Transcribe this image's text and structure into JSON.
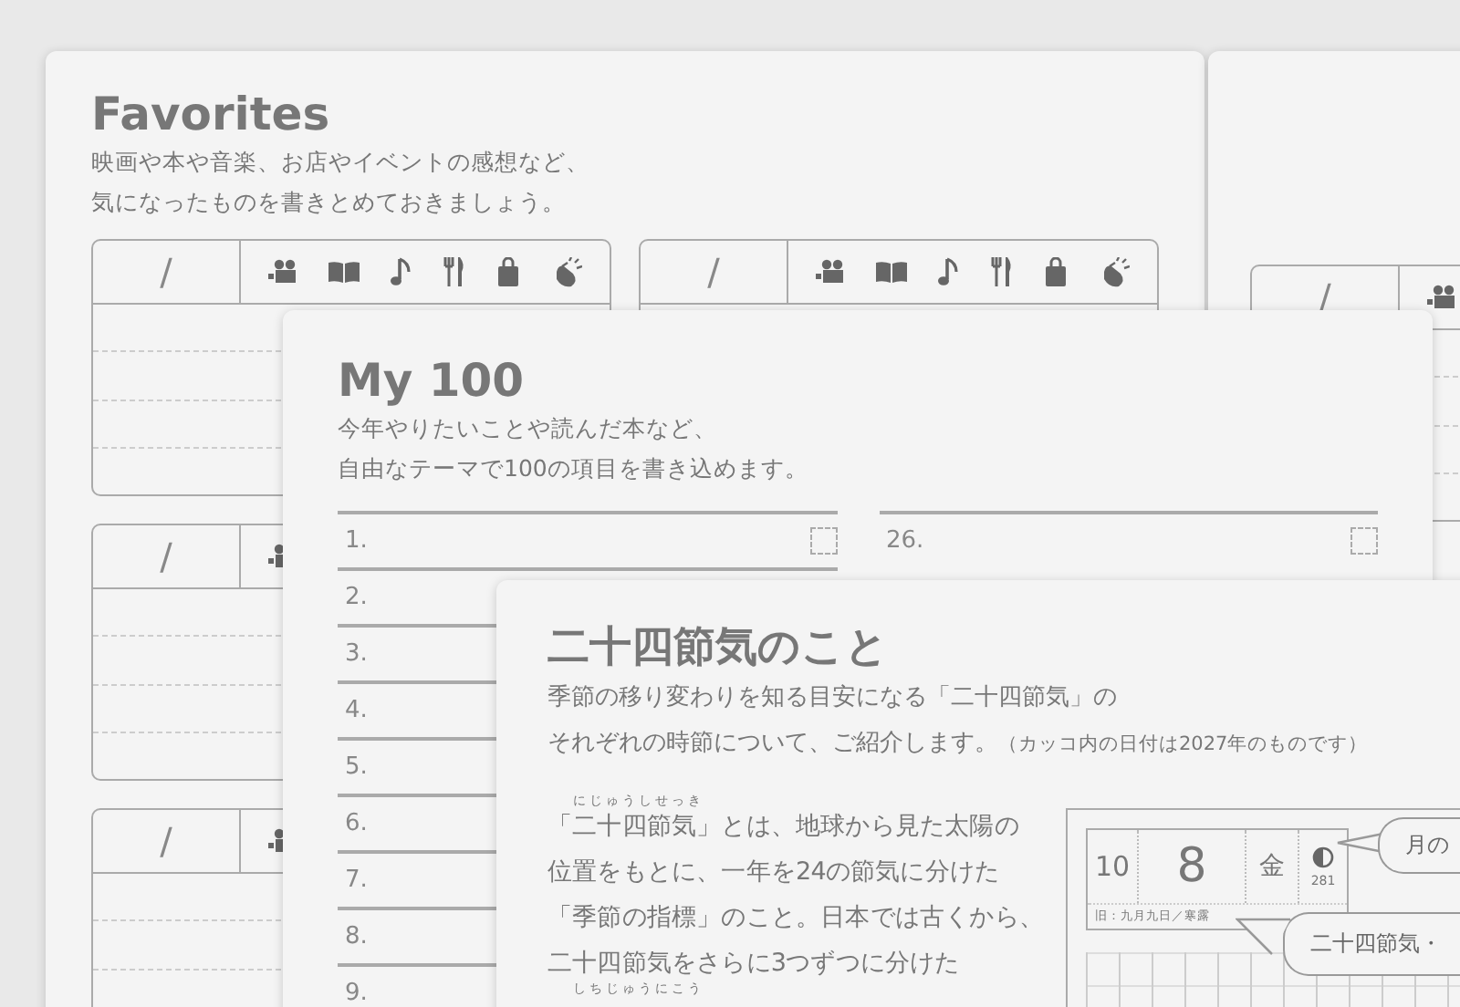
{
  "favorites_page": {
    "title": "Favorites",
    "description_lines": [
      "映画や本や音楽、お店やイベントの感想など、",
      "気になったものを書きとめておきましょう。"
    ],
    "card_rows": [
      {
        "cards": [
          {
            "date_slash": "/"
          },
          {
            "date_slash": "/"
          }
        ]
      },
      {
        "cards": [
          {
            "date_slash": "/"
          }
        ]
      },
      {
        "cards": [
          {
            "date_slash": "/"
          }
        ]
      }
    ]
  },
  "next_favorites_page": {
    "cards": [
      {
        "date_slash": "/"
      }
    ]
  },
  "my100_page": {
    "title": "My 100",
    "description_lines": [
      "今年やりたいことや読んだ本など、",
      "自由なテーマで100の項目を書き込めます。"
    ],
    "columns": [
      {
        "items": [
          {
            "number": "1.",
            "checked": false
          },
          {
            "number": "2."
          },
          {
            "number": "3."
          },
          {
            "number": "4."
          },
          {
            "number": "5."
          },
          {
            "number": "6."
          },
          {
            "number": "7."
          },
          {
            "number": "8."
          },
          {
            "number": "9."
          }
        ]
      },
      {
        "items": [
          {
            "number": "26.",
            "checked": false
          }
        ]
      }
    ]
  },
  "sekki_page": {
    "title": "二十四節気のこと",
    "description_lines": [
      {
        "text": "季節の移り変わりを知る目安になる「二十四節気」の"
      },
      {
        "text": "それぞれの時節について、ご紹介します。",
        "note": "（カッコ内の日付は2027年のものです）"
      }
    ],
    "body_lines": [
      {
        "ruby": "にじゅうしせっき",
        "text": "「二十四節気」とは、地球から見た太陽の"
      },
      {
        "text": "位置をもとに、一年を24の節気に分けた"
      },
      {
        "text": "「季節の指標」のこと。日本では古くから、"
      },
      {
        "text": "二十四節気をさらに3つずつに分けた"
      }
    ],
    "trailing_ruby": "しちじゅうにこう",
    "diagram": {
      "month": "10",
      "day": "8",
      "weekday": "金",
      "day_of_year": "281",
      "old_calendar": "旧：九月九日／寒露",
      "callouts": [
        "月の",
        "二十四節気・"
      ]
    }
  }
}
